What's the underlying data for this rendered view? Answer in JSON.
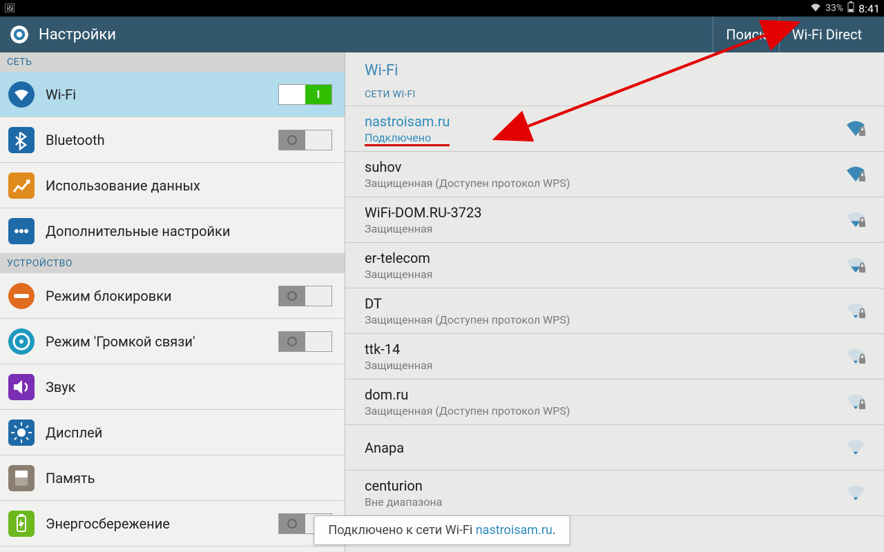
{
  "statusbar": {
    "battery_pct": "33%",
    "clock": "8:41"
  },
  "actionbar": {
    "title": "Настройки",
    "search_label": "Поиск",
    "wifi_direct_label": "Wi-Fi Direct"
  },
  "sidebar": {
    "sections": [
      {
        "title": "СЕТЬ",
        "items": [
          {
            "label": "Wi-Fi",
            "icon": "wifi",
            "toggle": "on",
            "selected": true
          },
          {
            "label": "Bluetooth",
            "icon": "bluetooth",
            "toggle": "off"
          },
          {
            "label": "Использование данных",
            "icon": "data"
          },
          {
            "label": "Дополнительные настройки",
            "icon": "more"
          }
        ]
      },
      {
        "title": "УСТРОЙСТВО",
        "items": [
          {
            "label": "Режим блокировки",
            "icon": "block",
            "toggle": "off"
          },
          {
            "label": "Режим 'Громкой связи'",
            "icon": "drive",
            "toggle": "off"
          },
          {
            "label": "Звук",
            "icon": "sound"
          },
          {
            "label": "Дисплей",
            "icon": "display"
          },
          {
            "label": "Память",
            "icon": "storage"
          },
          {
            "label": "Энергосбережение",
            "icon": "power",
            "toggle": "off"
          }
        ]
      }
    ]
  },
  "main": {
    "title": "Wi-Fi",
    "list_header": "СЕТИ WI-FI",
    "networks": [
      {
        "ssid": "nastroisam.ru",
        "status": "Подключено",
        "connected": true,
        "locked": true,
        "strength": 4
      },
      {
        "ssid": "suhov",
        "status": "Защищенная (Доступен протокол WPS)",
        "connected": false,
        "locked": true,
        "strength": 4
      },
      {
        "ssid": "WiFi-DOM.RU-3723",
        "status": "Защищенная",
        "connected": false,
        "locked": true,
        "strength": 2
      },
      {
        "ssid": "er-telecom",
        "status": "Защищенная",
        "connected": false,
        "locked": true,
        "strength": 2
      },
      {
        "ssid": "DT",
        "status": "Защищенная (Доступен протокол WPS)",
        "connected": false,
        "locked": true,
        "strength": 1
      },
      {
        "ssid": "ttk-14",
        "status": "Защищенная",
        "connected": false,
        "locked": true,
        "strength": 1
      },
      {
        "ssid": "dom.ru",
        "status": "Защищенная (Доступен протокол WPS)",
        "connected": false,
        "locked": true,
        "strength": 1
      },
      {
        "ssid": "Anapa",
        "status": "",
        "connected": false,
        "locked": false,
        "strength": 1
      },
      {
        "ssid": "centurion",
        "status": "Вне диапазона",
        "connected": false,
        "locked": false,
        "strength": 0
      }
    ]
  },
  "toast": {
    "prefix": "Подключено к сети Wi-Fi ",
    "link": "nastroisam.ru",
    "suffix": "."
  },
  "accent": "#2f8bbd",
  "icons": {
    "wifi": "#1e6aa8",
    "bluetooth": "#1e6aa8",
    "data": "#e08b1d",
    "more": "#1e6aa8",
    "block": "#e06a1d",
    "drive": "#1e98c0",
    "sound": "#7b2fb4",
    "display": "#1e6aa8",
    "storage": "#8a7e70",
    "power": "#6db81d"
  }
}
